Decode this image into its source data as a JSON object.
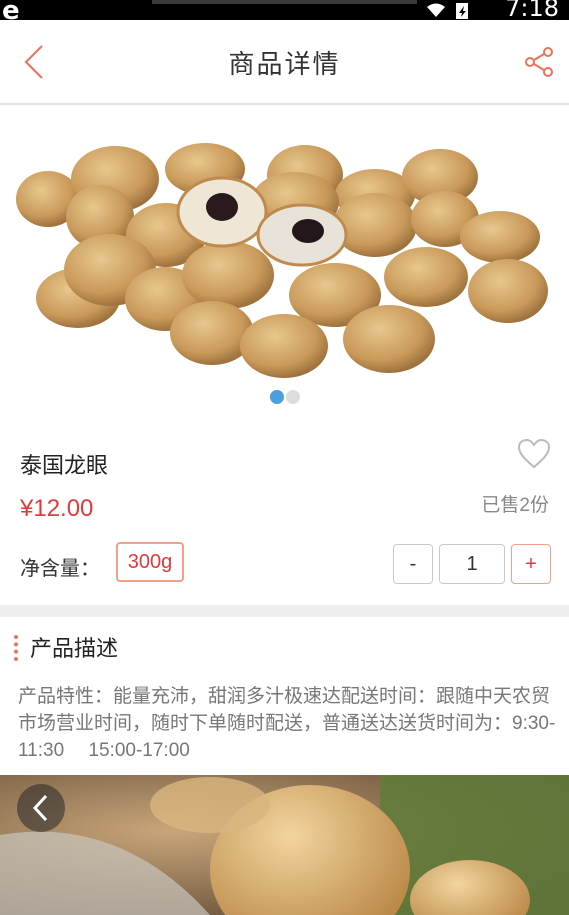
{
  "status_bar": {
    "time": "7:18",
    "logo": "e"
  },
  "header": {
    "title": "商品详情",
    "back_icon": "chevron-left-icon",
    "share_icon": "share-icon"
  },
  "gallery": {
    "image": "longan-fruit-photo",
    "slide_count": 2,
    "active_slide": 1
  },
  "product": {
    "name": "泰国龙眼",
    "price": "¥12.00",
    "sold": "已售2份",
    "net_label": "净含量：",
    "net_value": "300g",
    "quantity": "1",
    "minus": "-",
    "plus": "+"
  },
  "description": {
    "heading": "产品描述",
    "text": "产品特性：能量充沛，甜润多汁极速达配送时间：跟随中天农贸市场营业时间，随时下单随时配送，普通送达送货时间为：9:30-11:30　 15:00-17:00"
  },
  "banner": {
    "image": "longan-closeup-photo",
    "nav_icon": "chevron-left-icon"
  },
  "colors": {
    "accent_red": "#e03a3a",
    "border_orange": "#f1a08b",
    "dot_blue": "#4a9fdc"
  }
}
